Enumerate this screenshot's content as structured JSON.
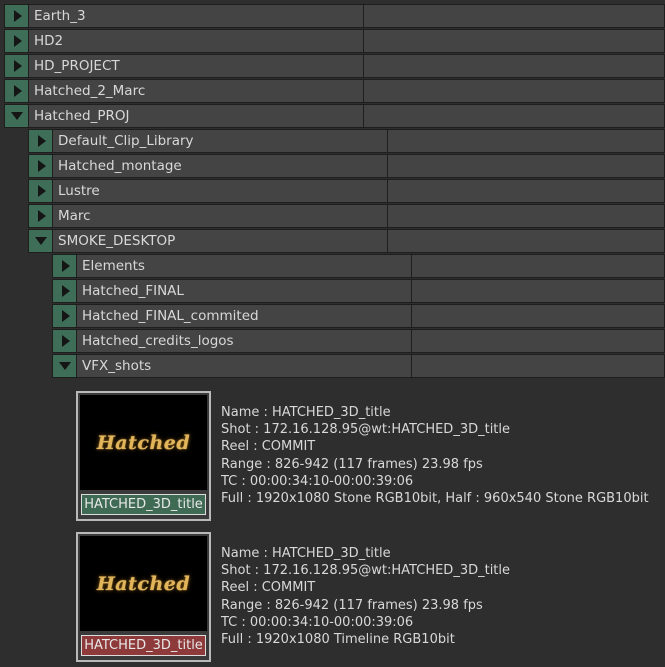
{
  "tree": [
    {
      "label": "Earth_3",
      "expanded": false
    },
    {
      "label": "HD2",
      "expanded": false
    },
    {
      "label": "HD_PROJECT",
      "expanded": false
    },
    {
      "label": "Hatched_2_Marc",
      "expanded": false
    },
    {
      "label": "Hatched_PROJ",
      "expanded": true
    },
    {
      "label": "Default_Clip_Library",
      "expanded": false
    },
    {
      "label": "Hatched_montage",
      "expanded": false
    },
    {
      "label": "Lustre",
      "expanded": false
    },
    {
      "label": "Marc",
      "expanded": false
    },
    {
      "label": "SMOKE_DESKTOP",
      "expanded": true
    },
    {
      "label": "Elements",
      "expanded": false
    },
    {
      "label": "Hatched_FINAL",
      "expanded": false
    },
    {
      "label": "Hatched_FINAL_commited",
      "expanded": false
    },
    {
      "label": "Hatched_credits_logos",
      "expanded": false
    },
    {
      "label": "VFX_shots",
      "expanded": true
    }
  ],
  "clips": [
    {
      "thumb_text": "Hatched",
      "name": "HATCHED_3D_title",
      "name_bg": "#3f6b55",
      "info": [
        "Name : HATCHED_3D_title",
        "Shot : 172.16.128.95@wt:HATCHED_3D_title",
        "Reel : COMMIT",
        "Range : 826-942 (117 frames) 23.98 fps",
        "TC : 00:00:34:10-00:00:39:06",
        "Full : 1920x1080  Stone RGB10bit,  Half : 960x540  Stone RGB10bit"
      ]
    },
    {
      "thumb_text": "Hatched",
      "name": "HATCHED_3D_title",
      "name_bg": "#8e3a3a",
      "info": [
        "Name : HATCHED_3D_title",
        "Shot : 172.16.128.95@wt:HATCHED_3D_title",
        "Reel : COMMIT",
        "Range : 826-942 (117 frames) 23.98 fps",
        "TC : 00:00:34:10-00:00:39:06",
        "Full : 1920x1080  Timeline RGB10bit"
      ]
    }
  ],
  "colors": {
    "background": "#2e2e2e",
    "row": "#444444",
    "toggle": "#3e6d58"
  }
}
